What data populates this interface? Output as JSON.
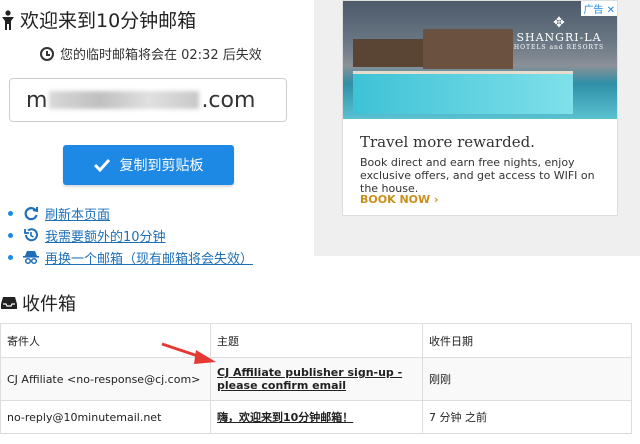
{
  "header": {
    "title": "欢迎来到10分钟邮箱"
  },
  "timer": {
    "text": "您的临时邮箱将会在 02:32 后失效"
  },
  "email": {
    "prefix": "m",
    "suffix": ".com"
  },
  "copy_button": {
    "label": "复制到剪贴板"
  },
  "links": [
    {
      "label": "刷新本页面",
      "icon": "refresh-icon"
    },
    {
      "label": "我需要额外的10分钟",
      "icon": "history-icon"
    },
    {
      "label": "再换一个邮箱（现有邮箱将会失效）",
      "icon": "incognito-icon"
    }
  ],
  "ad": {
    "badge": "广告",
    "brand_name": "SHANGRI-LA",
    "brand_sub": "HOTELS and RESORTS",
    "headline": "Travel more rewarded.",
    "body": "Book direct and earn free nights, enjoy exclusive offers, and get access to WIFI on the house.",
    "cta": "BOOK NOW ›"
  },
  "inbox": {
    "title": "收件箱",
    "columns": [
      "寄件人",
      "主题",
      "收件日期"
    ],
    "rows": [
      {
        "sender": "CJ Affiliate <no-response@cj.com>",
        "subject": "CJ Affiliate publisher sign-up - please confirm email",
        "date": "刚刚"
      },
      {
        "sender": "no-reply@10minutemail.net",
        "subject": "嗨，欢迎来到10分钟邮箱！",
        "date": "7 分钟 之前"
      }
    ]
  },
  "colors": {
    "accent": "#1e88e5",
    "link": "#1e6fb8",
    "arrow": "#e53935"
  }
}
